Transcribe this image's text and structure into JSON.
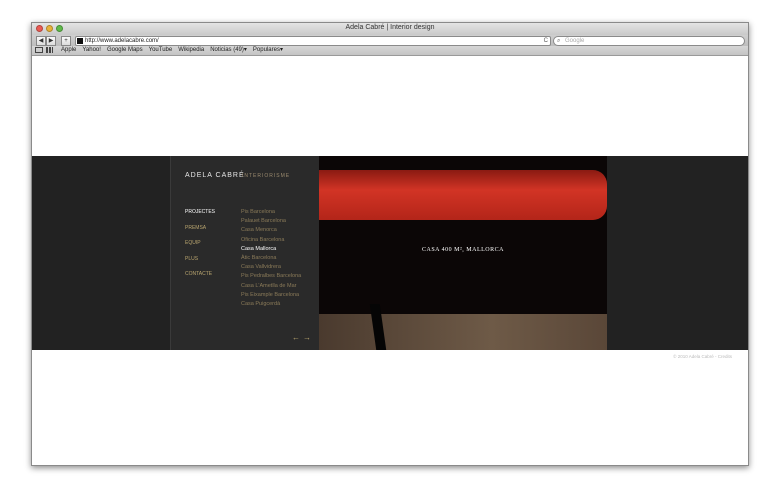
{
  "browser": {
    "window_title": "Adela Cabré | Interior design",
    "nav": {
      "back": "◀",
      "forward": "▶",
      "add": "+"
    },
    "url": "http://www.adelacabre.com/",
    "reload": "C",
    "search_placeholder": "Google",
    "bookmarks": [
      "Apple",
      "Yahoo!",
      "Google Maps",
      "YouTube",
      "Wikipedia",
      "Noticias (49)▾",
      "Populares▾"
    ]
  },
  "site": {
    "brand": "ADELA CABRÉ",
    "tagline": "INTERIORISME",
    "nav": [
      "PROJECTES",
      "PREMSA",
      "EQUIP",
      "PLUS",
      "CONTACTE"
    ],
    "nav_active_index": 0,
    "projects": [
      "Pis Barcelona",
      "Palauet Barcelona",
      "Casa Menorca",
      "Oficina Barcelona",
      "Casa Mallorca",
      "Àtic Barcelona",
      "Casa Vallvidrera",
      "Pis Pedralbes Barcelona",
      "Casa L'Ametlla de Mar",
      "Pis Eixample Barcelona",
      "Casa Puigcerdà"
    ],
    "project_active_index": 4,
    "arrows": {
      "prev": "←",
      "next": "→"
    },
    "photo_caption": "CASA 400 M², MALLORCA",
    "copyright": "© 2010 Adela Cabré - Credits"
  }
}
